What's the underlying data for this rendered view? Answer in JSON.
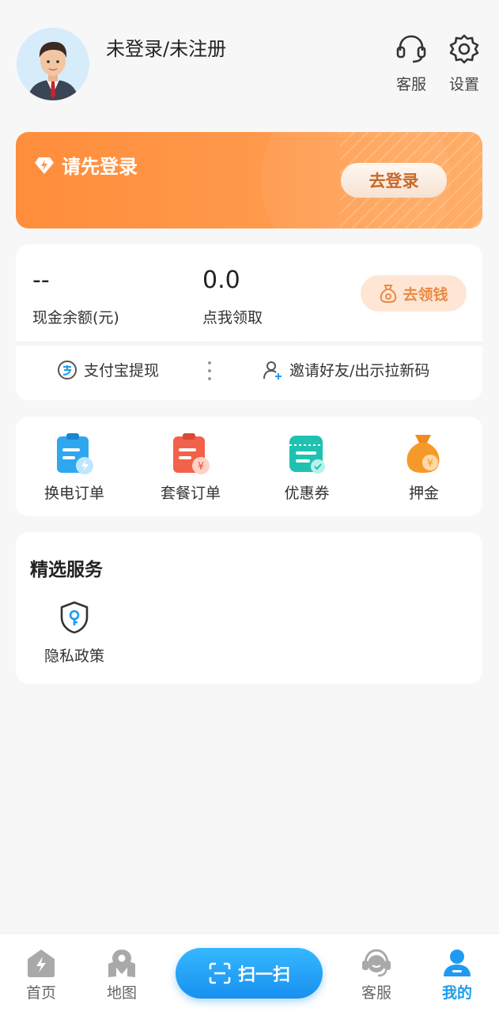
{
  "header": {
    "login_status": "未登录/未注册",
    "customer_service_label": "客服",
    "settings_label": "设置"
  },
  "banner": {
    "title": "请先登录",
    "login_button": "去登录",
    "colors": {
      "start": "#ff8d3b",
      "end": "#ffae68"
    }
  },
  "wallet": {
    "balance_value": "--",
    "balance_caption": "现金余额(元)",
    "claim_value": "0.0",
    "claim_caption": "点我领取",
    "get_money_button": "去领钱",
    "alipay_withdraw": "支付宝提现",
    "invite_friends": "邀请好友/出示拉新码"
  },
  "orders": [
    {
      "label": "换电订单",
      "icon": "swap-battery-order-icon",
      "color": "#2ea7ef"
    },
    {
      "label": "套餐订单",
      "icon": "package-order-icon",
      "color": "#f2614a"
    },
    {
      "label": "优惠券",
      "icon": "coupon-icon",
      "color": "#1fc2b0"
    },
    {
      "label": "押金",
      "icon": "deposit-bag-icon",
      "color": "#f59a2a"
    }
  ],
  "services": {
    "title": "精选服务",
    "items": [
      {
        "label": "隐私政策",
        "icon": "privacy-shield-icon"
      }
    ]
  },
  "tabbar": {
    "home": "首页",
    "map": "地图",
    "scan": "扫一扫",
    "customer_service": "客服",
    "me": "我的",
    "active": "me",
    "active_color": "#1e9bf0"
  }
}
